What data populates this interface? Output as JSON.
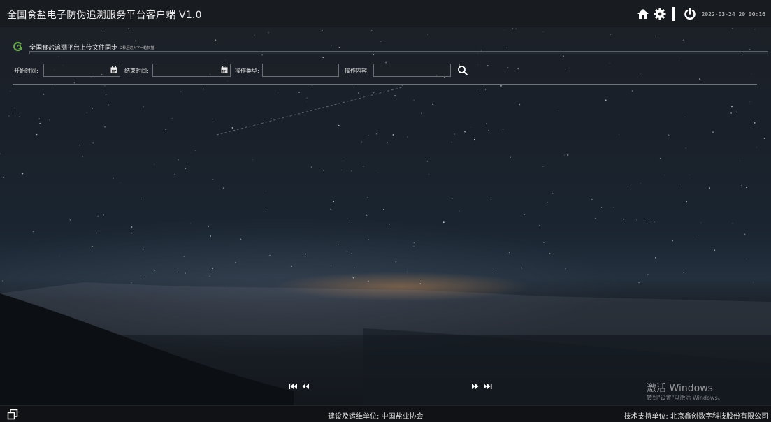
{
  "app": {
    "title": "全国食盐电子防伪追溯服务平台客户端 V1.0"
  },
  "header": {
    "icons": [
      "home-icon",
      "gear-icon",
      "power-icon"
    ],
    "datetime": "2022-03-24 20:00:16"
  },
  "sync": {
    "icon": "sync-logo-icon",
    "title": "全国食盐追溯平台上传文件同步",
    "subtitle": "2秒后进入下一轮扫描",
    "progress_fraction": 0.0
  },
  "filters": {
    "start_label": "开始时间:",
    "start_value": "",
    "end_label": "结束时间:",
    "end_value": "",
    "type_label": "操作类型:",
    "type_value": "",
    "content_label": "操作内容:",
    "content_value": "",
    "search_icon": "search-icon",
    "calendar_icon": "calendar-icon"
  },
  "pagination": {
    "icons": [
      "first-page-icon",
      "prev-page-icon",
      "next-page-icon",
      "last-page-icon"
    ]
  },
  "watermark": {
    "line1": "激活 Windows",
    "line2": "转到\"设置\"以激活 Windows。"
  },
  "footer": {
    "window_icon": "window-restore-icon",
    "builder": "建设及运维单位:  中国盐业协会",
    "support": "技术支持单位:  北京鑫创数字科技股份有限公司"
  },
  "colors": {
    "accent_green": "#6aa84f",
    "topbar": "#181a1e",
    "footer": "#101215"
  }
}
